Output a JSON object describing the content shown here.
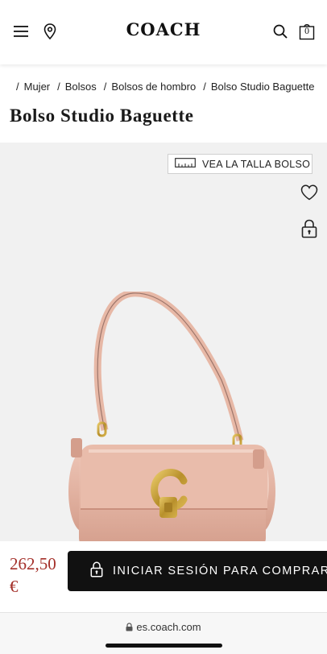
{
  "header": {
    "logo": "COACH",
    "bag_count": "0"
  },
  "breadcrumb": {
    "items": [
      "Mujer",
      "Bolsos",
      "Bolsos de hombro",
      "Bolso Studio Baguette"
    ]
  },
  "product": {
    "title": "Bolso Studio Baguette",
    "size_guide_label": "VEA LA TALLA BOLSO",
    "price": "262,50 €"
  },
  "actions": {
    "login_label": "INICIAR SESIÓN PARA COMPRAR"
  },
  "browser": {
    "url": "es.coach.com"
  },
  "colors": {
    "price": "#a4302a",
    "button": "#111111",
    "gallery_bg": "#f1f1f1",
    "bag_leather": "#e6b7a7",
    "hardware": "#c9a23c"
  }
}
